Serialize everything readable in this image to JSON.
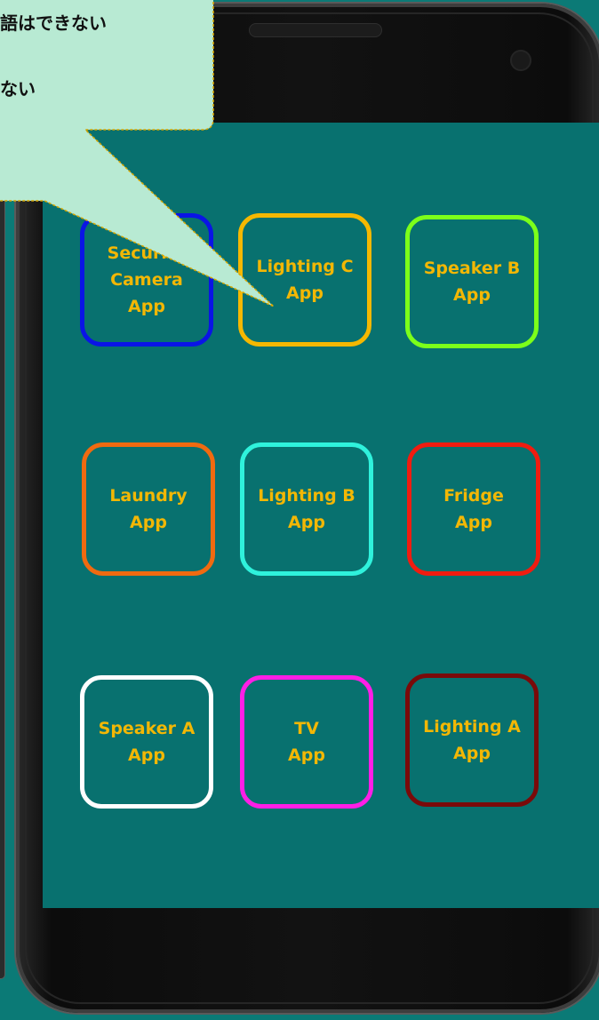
{
  "callout": {
    "line1": "語はできない",
    "line2": "ない"
  },
  "apps": [
    {
      "label": "Security\nCamera\nApp",
      "color": "#0a14e6"
    },
    {
      "label": "Lighting C\nApp",
      "color": "#f5b800"
    },
    {
      "label": "Speaker B\nApp",
      "color": "#7cff1a"
    },
    {
      "label": "Laundry\nApp",
      "color": "#f06a10"
    },
    {
      "label": "Lighting B\nApp",
      "color": "#2ff2dc"
    },
    {
      "label": "Fridge\nApp",
      "color": "#f01c10"
    },
    {
      "label": "Speaker A\nApp",
      "color": "#ffffff"
    },
    {
      "label": "TV\nApp",
      "color": "#ff1ee6"
    },
    {
      "label": "Lighting A\nApp",
      "color": "#7a0a0a"
    }
  ],
  "colors": {
    "background": "#0b7a76",
    "screen": "#08716f",
    "app_text": "#f2b705",
    "callout_fill": "#b8ead3",
    "callout_border": "#d9a800"
  }
}
